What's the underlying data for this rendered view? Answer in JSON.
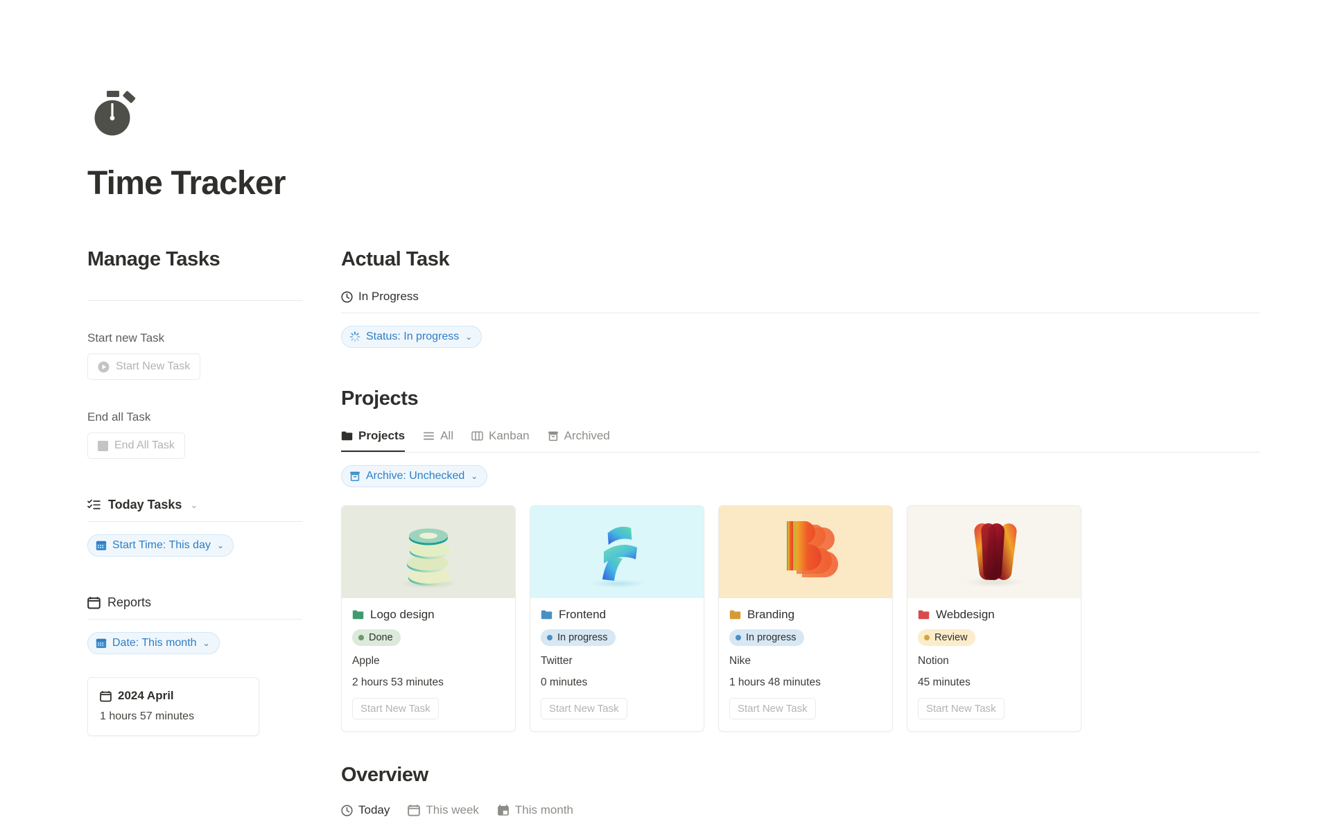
{
  "app": {
    "title": "Time Tracker",
    "logo_icon": "stopwatch-icon"
  },
  "sidebar": {
    "heading": "Manage Tasks",
    "start_new_task": {
      "label": "Start new Task",
      "button_label": "Start New Task",
      "icon": "play-circle-icon"
    },
    "end_all_task": {
      "label": "End all Task",
      "button_label": "End All Task",
      "icon": "stop-square-icon"
    },
    "today_tasks": {
      "label": "Today Tasks",
      "icon": "checklist-icon",
      "chevron": "⌄",
      "filter": {
        "label": "Start Time: This day",
        "icon": "calendar-grid-icon",
        "chevron": "⌄"
      }
    },
    "reports": {
      "label": "Reports",
      "icon": "calendar-icon",
      "filter": {
        "label": "Date: This month",
        "icon": "calendar-grid-icon",
        "chevron": "⌄"
      },
      "card": {
        "icon": "calendar-icon",
        "title": "2024 April",
        "duration": "1 hours 57 minutes"
      }
    }
  },
  "main": {
    "actual_task": {
      "heading": "Actual Task",
      "tab": {
        "label": "In Progress",
        "icon": "clock-icon"
      },
      "filter": {
        "label": "Status: In progress",
        "icon": "spinner-icon",
        "chevron": "⌄"
      }
    },
    "projects": {
      "heading": "Projects",
      "tabs": [
        {
          "label": "Projects",
          "icon": "folder-icon",
          "active": true
        },
        {
          "label": "All",
          "icon": "list-icon",
          "active": false
        },
        {
          "label": "Kanban",
          "icon": "columns-icon",
          "active": false
        },
        {
          "label": "Archived",
          "icon": "archive-icon",
          "active": false
        }
      ],
      "filter": {
        "label": "Archive: Unchecked",
        "icon": "archive-icon",
        "chevron": "⌄"
      },
      "cards": [
        {
          "name": "Logo design",
          "folder_icon": "folder-icon",
          "folder_color": "#3f9a6e",
          "status": "Done",
          "status_bg": "#dbeadb",
          "status_dot": "#6a9a6a",
          "client": "Apple",
          "duration": "2 hours 53 minutes",
          "button_label": "Start New Task",
          "cover_bg": "#e7eade",
          "art": "teal-coil-art"
        },
        {
          "name": "Frontend",
          "folder_icon": "folder-icon",
          "folder_color": "#4a8fc2",
          "status": "In progress",
          "status_bg": "#d7e7f3",
          "status_dot": "#4a8fc2",
          "client": "Twitter",
          "duration": "0 minutes",
          "button_label": "Start New Task",
          "cover_bg": "#dbf7fa",
          "art": "blue-green-f-art"
        },
        {
          "name": "Branding",
          "folder_icon": "folder-icon",
          "folder_color": "#d59b33",
          "status": "In progress",
          "status_bg": "#d7e7f3",
          "status_dot": "#4a8fc2",
          "client": "Nike",
          "duration": "1 hours 48 minutes",
          "button_label": "Start New Task",
          "cover_bg": "#fbe8c4",
          "art": "orange-b-art"
        },
        {
          "name": "Webdesign",
          "folder_icon": "folder-icon",
          "folder_color": "#d84b4b",
          "status": "Review",
          "status_bg": "#fbeccb",
          "status_dot": "#d4a53a",
          "client": "Notion",
          "duration": "45 minutes",
          "button_label": "Start New Task",
          "cover_bg": "#f7f5ee",
          "art": "red-w-art"
        }
      ]
    },
    "overview": {
      "heading": "Overview",
      "tabs": [
        {
          "label": "Today",
          "icon": "clock-icon",
          "active": true
        },
        {
          "label": "This week",
          "icon": "calendar-icon",
          "active": false
        },
        {
          "label": "This month",
          "icon": "calendar-filled-icon",
          "active": false
        }
      ]
    }
  },
  "colors": {
    "accent_blue": "#2f7dc4",
    "pill_bg": "#eff7fd",
    "text_dark": "#2f2f2c",
    "text_muted": "#8d8d88"
  }
}
